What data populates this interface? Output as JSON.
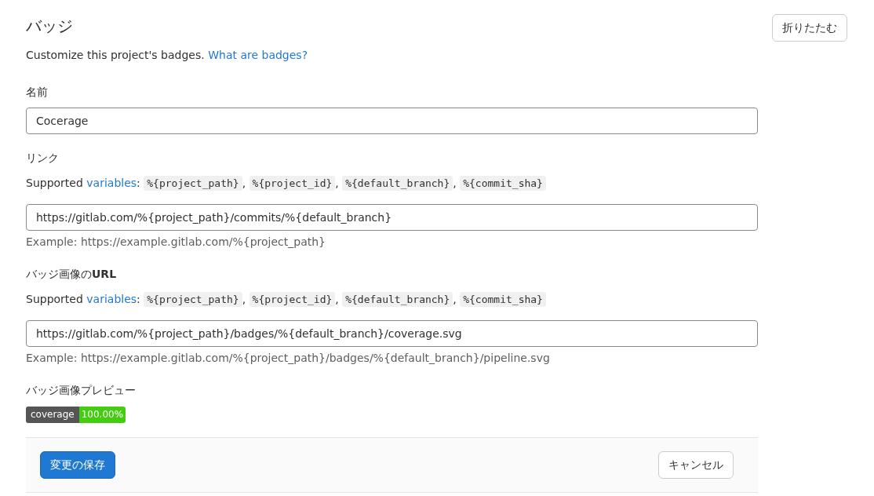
{
  "title": "バッジ",
  "collapse_button": "折りたたむ",
  "description": {
    "text": "Customize this project's badges.",
    "link": "What are badges?"
  },
  "fields": [
    {
      "kind": "text",
      "label": "名前",
      "value": "Cocerage"
    },
    {
      "kind": "url",
      "label": "リンク",
      "supported": {
        "prefix": "Supported",
        "link": "variables",
        "suffix": ":",
        "separator": ",",
        "variables": [
          "%{project_path}",
          "%{project_id}",
          "%{default_branch}",
          "%{commit_sha}"
        ]
      },
      "value": "https://gitlab.com/%{project_path}/commits/%{default_branch}",
      "example": "Example: https://example.gitlab.com/%{project_path}"
    },
    {
      "kind": "url",
      "label": "バッジ画像の**URL**",
      "supported": {
        "prefix": "Supported",
        "link": "variables",
        "suffix": ":",
        "separator": ",",
        "variables": [
          "%{project_path}",
          "%{project_id}",
          "%{default_branch}",
          "%{commit_sha}"
        ]
      },
      "value": "https://gitlab.com/%{project_path}/badges/%{default_branch}/coverage.svg",
      "example": "Example: https://example.gitlab.com/%{project_path}/badges/%{default_branch}/pipeline.svg"
    }
  ],
  "preview": {
    "label": "バッジ画像プレビュー",
    "badge": {
      "subject": "coverage",
      "status": "100.00%"
    }
  },
  "footer": {
    "save": "変更の保存",
    "cancel": "キャンセル"
  }
}
